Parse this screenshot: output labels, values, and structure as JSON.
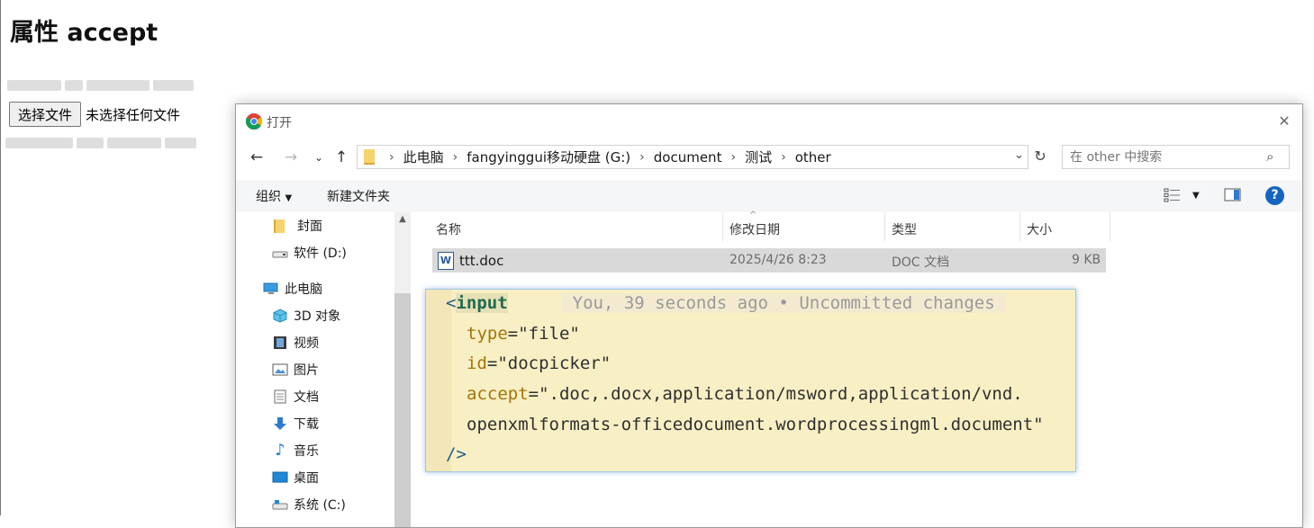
{
  "page": {
    "title": "属性 accept",
    "file_button_label": "选择文件",
    "file_status": "未选择任何文件"
  },
  "dialog": {
    "title": "打开",
    "breadcrumbs": [
      "此电脑",
      "fangyinggui移动硬盘 (G:)",
      "document",
      "测试",
      "other"
    ],
    "search_placeholder": "在 other 中搜索",
    "toolbar": {
      "organize": "组织",
      "new_folder": "新建文件夹"
    },
    "nav_items": [
      {
        "label": "封面",
        "icon": "folder-icon"
      },
      {
        "label": "软件 (D:)",
        "icon": "drive-icon"
      },
      {
        "label": "此电脑",
        "icon": "computer-icon"
      },
      {
        "label": "3D 对象",
        "icon": "3d-objects-icon"
      },
      {
        "label": "视频",
        "icon": "video-icon"
      },
      {
        "label": "图片",
        "icon": "pictures-icon"
      },
      {
        "label": "文档",
        "icon": "documents-icon"
      },
      {
        "label": "下载",
        "icon": "downloads-icon"
      },
      {
        "label": "音乐",
        "icon": "music-icon"
      },
      {
        "label": "桌面",
        "icon": "desktop-icon"
      },
      {
        "label": "系统 (C:)",
        "icon": "system-drive-icon"
      }
    ],
    "columns": [
      "名称",
      "修改日期",
      "类型",
      "大小"
    ],
    "files": [
      {
        "name": "ttt.doc",
        "modified": "2025/4/26 8:23",
        "type": "DOC 文档",
        "size": "9 KB"
      }
    ]
  },
  "tooltip": {
    "tag_open": "input",
    "blame": "You, 39 seconds ago • Uncommitted changes",
    "attrs": [
      {
        "name": "type",
        "value": "\"file\""
      },
      {
        "name": "id",
        "value": "\"docpicker\""
      },
      {
        "name": "accept",
        "value": "\".doc,.docx,application/msword,application/vnd."
      }
    ],
    "continuation": "openxmlformats-officedocument.wordprocessingml.document\"",
    "close": "/>"
  },
  "colors": {
    "accent": "#1565c0",
    "tooltip_bg": "#f8efc4",
    "selected_row": "#d9d9d9",
    "attr_color": "#a4740d",
    "tag_color": "#1f5f8b"
  }
}
